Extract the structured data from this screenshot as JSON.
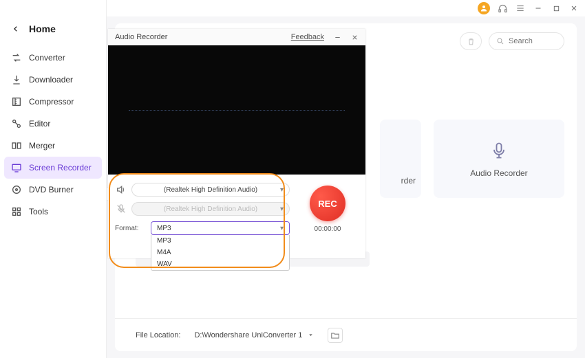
{
  "titlebar": {
    "user_color": "#f5a623"
  },
  "sidebar": {
    "home": "Home",
    "items": [
      {
        "label": "Converter"
      },
      {
        "label": "Downloader"
      },
      {
        "label": "Compressor"
      },
      {
        "label": "Editor"
      },
      {
        "label": "Merger"
      },
      {
        "label": "Screen Recorder"
      },
      {
        "label": "DVD Burner"
      },
      {
        "label": "Tools"
      }
    ]
  },
  "search": {
    "placeholder": "Search"
  },
  "cards": {
    "screen": "rder",
    "audio": "Audio Recorder"
  },
  "footer": {
    "label": "File Location:",
    "path": "D:\\Wondershare UniConverter 1"
  },
  "modal": {
    "title": "Audio Recorder",
    "feedback": "Feedback",
    "speaker_device": "(Realtek High Definition Audio)",
    "mic_device": "(Realtek High Definition Audio)",
    "format_label": "Format:",
    "format_value": "MP3",
    "format_options": [
      "MP3",
      "M4A",
      "WAV"
    ],
    "rec_label": "REC",
    "time": "00:00:00"
  }
}
